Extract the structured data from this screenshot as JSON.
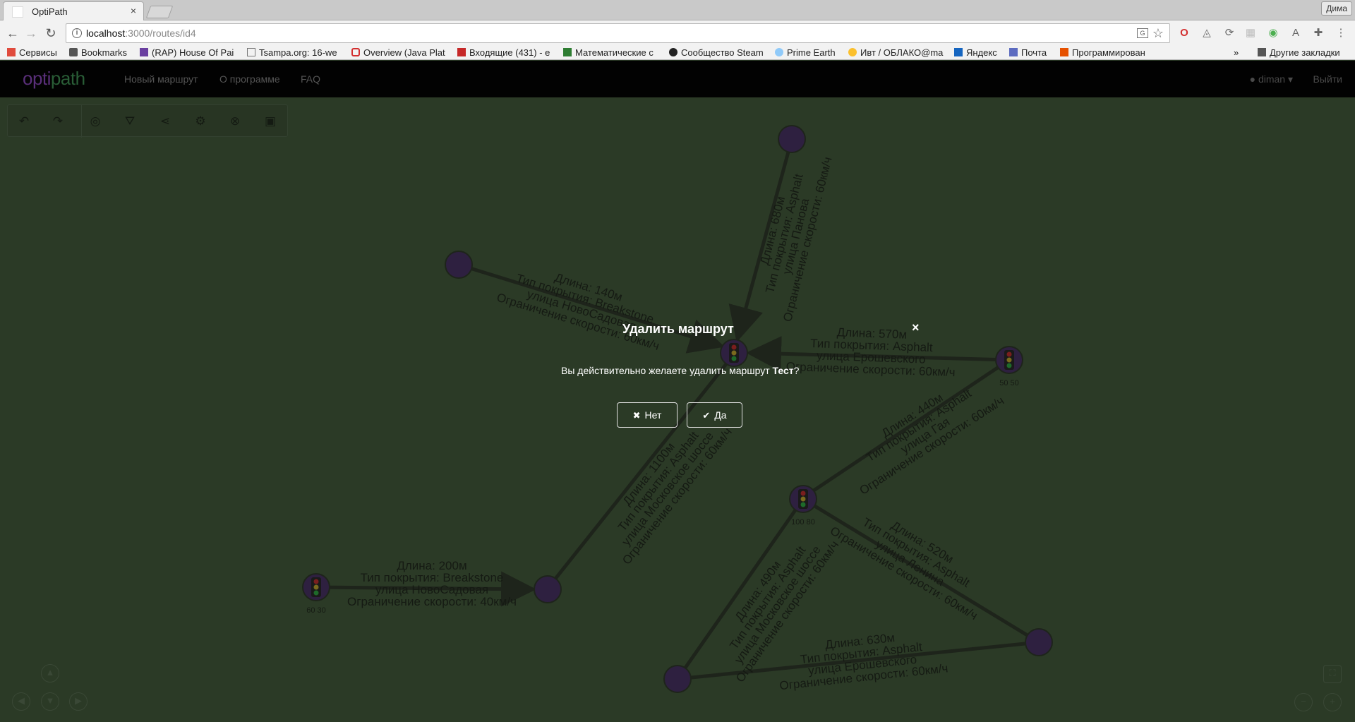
{
  "browser": {
    "tab_title": "OptiPath",
    "tab_close": "×",
    "profile": "Дима",
    "url_host": "localhost",
    "url_path": ":3000/routes/id4",
    "bookmarks": [
      {
        "label": "Сервисы",
        "color": "#e04b3d"
      },
      {
        "label": "Bookmarks",
        "color": "#555555"
      },
      {
        "label": "(RAP) House Of Pai",
        "color": "#6a3fa0"
      },
      {
        "label": "Tsampa.org: 16-we",
        "color": "#777777"
      },
      {
        "label": "Overview (Java Plat",
        "color": "#d32f2f"
      },
      {
        "label": "Входящие (431) - e",
        "color": "#c62828"
      },
      {
        "label": "Математические с",
        "color": "#2e7d32"
      },
      {
        "label": "Сообщество Steam",
        "color": "#222222"
      },
      {
        "label": "Prime Earth",
        "color": "#90caf9"
      },
      {
        "label": "Ивт / ОБЛАКО@ma",
        "color": "#fbc02d"
      },
      {
        "label": "Яндекс",
        "color": "#1565c0"
      },
      {
        "label": "Почта",
        "color": "#5c6bc0"
      },
      {
        "label": "Программирован",
        "color": "#e65100"
      }
    ],
    "other_bookmarks": "Другие закладки",
    "overflow": "»"
  },
  "app": {
    "logo_a": "opti",
    "logo_dot": "path",
    "nav": [
      "Новый маршрут",
      "О программе",
      "FAQ"
    ],
    "user": "diman",
    "logout": "Выйти"
  },
  "graph": {
    "edges": [
      {
        "lines": [
          "Длина: 680м",
          "Тип покрытия: Asphalt",
          "улица Панова",
          "Ограничение скорости: 60км/ч"
        ]
      },
      {
        "lines": [
          "Длина: 140м",
          "Тип покрытия: Breakstone",
          "улица НовоСадовая",
          "Ограничение скорости: 60км/ч"
        ]
      },
      {
        "lines": [
          "Длина: 570м",
          "Тип покрытия: Asphalt",
          "улица Ерошевского",
          "Ограничение скорости: 60км/ч"
        ]
      },
      {
        "lines": [
          "Длина: 440м",
          "Тип покрытия: Asphalt",
          "улица Гая",
          "Ограничение скорости: 60км/ч"
        ]
      },
      {
        "lines": [
          "Длина: 1100м",
          "Тип покрытия: Asphalt",
          "улица Московское шоссе",
          "Ограничение скорости: 60км/ч"
        ]
      },
      {
        "lines": [
          "Длина: 200м",
          "Тип покрытия: Breakstone",
          "улица НовоСадовая",
          "Ограничение скорости: 40км/ч"
        ]
      },
      {
        "lines": [
          "Длина: 490м",
          "Тип покрытия: Asphalt",
          "улица Московское шоссе",
          "Ограничение скорости: 60км/ч"
        ]
      },
      {
        "lines": [
          "Длина: 520м",
          "Тип покрытия: Asphalt",
          "улица Ленина",
          "Ограничение скорости: 60км/ч"
        ]
      },
      {
        "lines": [
          "Длина: 630м",
          "Тип покрытия: Asphalt",
          "улица Ерошевского",
          "Ограничение скорости: 60км/ч"
        ]
      }
    ],
    "node_labels": [
      "60 30",
      "50 50",
      "100 80"
    ]
  },
  "modal": {
    "title": "Удалить маршрут",
    "close": "×",
    "text_before": "Вы действительно желаете удалить маршрут ",
    "route_name": "Тест",
    "text_after": "?",
    "no_label": "Нет",
    "yes_label": "Да"
  }
}
